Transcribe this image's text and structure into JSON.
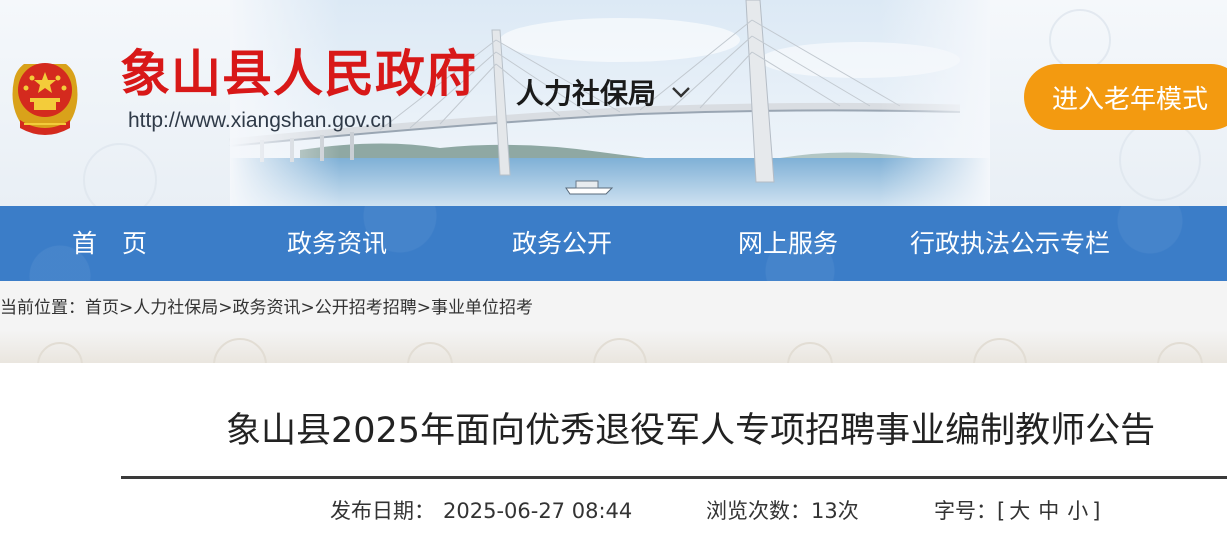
{
  "banner": {
    "site_title": "象山县人民政府",
    "site_url": "http://www.xiangshan.gov.cn",
    "dept_selected": "人力社保局",
    "elder_mode_label": "进入老年模式",
    "emblem_icon": "national-emblem-icon",
    "colors": {
      "title": "#d81818",
      "elder_button": "#f39a10"
    }
  },
  "nav": {
    "items": [
      "首　页",
      "政务资讯",
      "政务公开",
      "网上服务",
      "行政执法公示专栏"
    ],
    "background": "#3b7dc8"
  },
  "breadcrumb": {
    "prefix": "当前位置：",
    "items": [
      "首页",
      "人力社保局",
      "政务资讯",
      "公开招考招聘",
      "事业单位招考"
    ],
    "separator": ">"
  },
  "article": {
    "title": "象山县2025年面向优秀退役军人专项招聘事业编制教师公告",
    "publish_label": "发布日期：",
    "publish_value": "2025-06-27 08:44",
    "views_label": "浏览次数：",
    "views_value": "13次",
    "fontsize_label": "字号：",
    "fontsize_open": "[",
    "fontsize_large": "大",
    "fontsize_medium": "中",
    "fontsize_small": "小",
    "fontsize_close": "]"
  }
}
